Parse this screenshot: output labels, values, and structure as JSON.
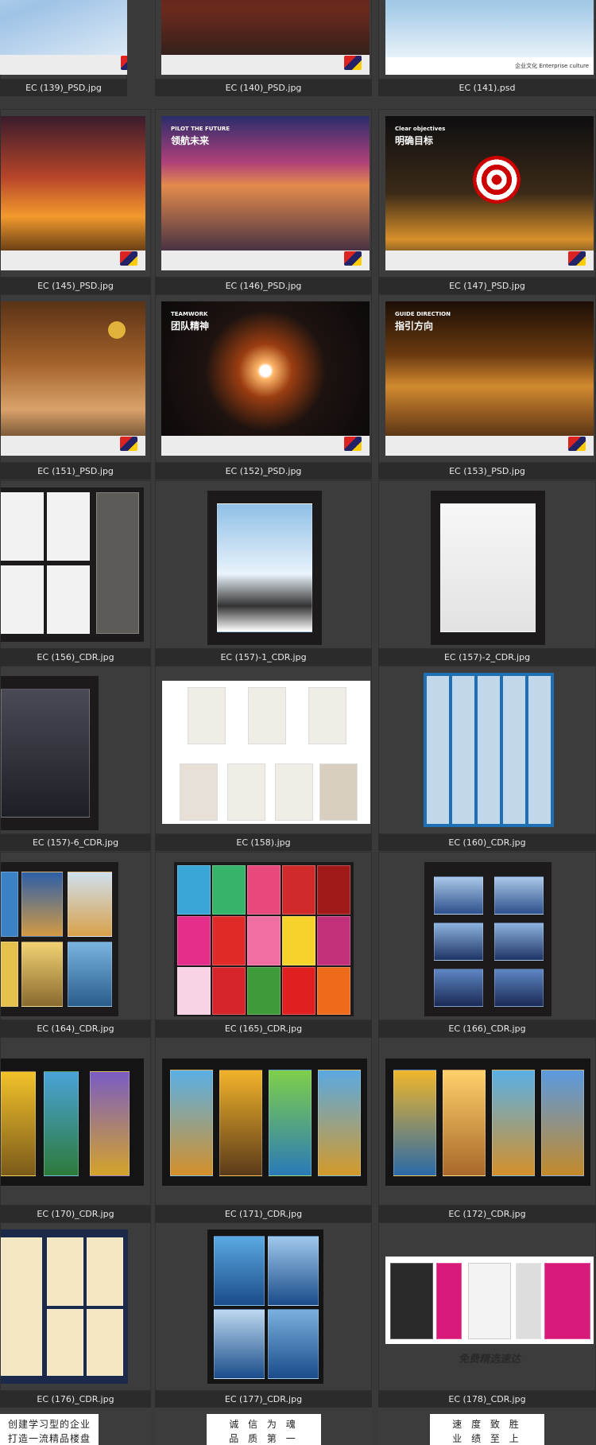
{
  "captions": {
    "r0": [
      "EC (139)_PSD.jpg",
      "EC (140)_PSD.jpg",
      "EC (141).psd"
    ],
    "r1": [
      "EC (145)_PSD.jpg",
      "EC (146)_PSD.jpg",
      "EC (147)_PSD.jpg"
    ],
    "r2": [
      "EC (151)_PSD.jpg",
      "EC (152)_PSD.jpg",
      "EC (153)_PSD.jpg"
    ],
    "r3": [
      "EC (156)_CDR.jpg",
      "EC (157)-1_CDR.jpg",
      "EC (157)-2_CDR.jpg"
    ],
    "r4": [
      "EC (157)-6_CDR.jpg",
      "EC (158).jpg",
      "EC (160)_CDR.jpg"
    ],
    "r5": [
      "EC (164)_CDR.jpg",
      "EC (165)_CDR.jpg",
      "EC (166)_CDR.jpg"
    ],
    "r6": [
      "EC (170)_CDR.jpg",
      "EC (171)_CDR.jpg",
      "EC (172)_CDR.jpg"
    ],
    "r7": [
      "EC (176)_CDR.jpg",
      "EC (177)_CDR.jpg",
      "EC (178)_CDR.jpg"
    ]
  },
  "overlay_text": {
    "pilot_title": "PILOT THE FUTURE",
    "pilot_cn": "领航未来",
    "clear_title": "Clear objectives",
    "clear_cn": "明确目标",
    "teamwork_title": "TEAMWORK",
    "teamwork_cn": "团队精神",
    "guide_title": "GUIDE DIRECTION",
    "guide_cn": "指引方向",
    "enterprise_culture": "企业文化 Enterprise culture",
    "watermark": "免费精选速达"
  },
  "partial_row": {
    "left": "创建学习型的企业",
    "left2": "打造一流精品楼盘",
    "mid": "诚 信 为 魂",
    "mid2": "品 质 第 一",
    "right": "速 度 致 胜",
    "right2": "业 绩 至 上"
  },
  "colors": {
    "background": "#3a3a3a",
    "caption_bar": "#2b2b2b",
    "caption_text": "#e8e8e8"
  }
}
